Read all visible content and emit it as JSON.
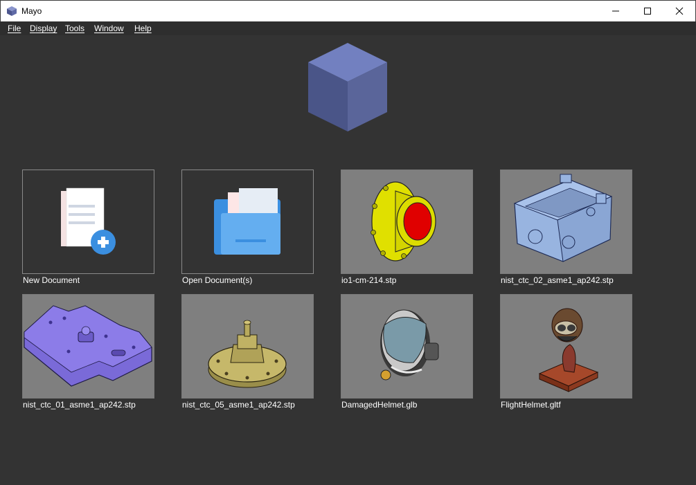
{
  "window": {
    "title": "Mayo",
    "icon": "cube-icon",
    "controls": [
      "minimize-icon",
      "maximize-icon",
      "close-icon"
    ]
  },
  "menu": [
    "File",
    "Display",
    "Tools",
    "Window",
    "Help"
  ],
  "actions": {
    "new_document": "New Document",
    "open_documents": "Open Document(s)"
  },
  "recent_files": [
    "io1-cm-214.stp",
    "nist_ctc_02_asme1_ap242.stp",
    "nist_ctc_01_asme1_ap242.stp",
    "nist_ctc_05_asme1_ap242.stp",
    "DamagedHelmet.glb",
    "FlightHelmet.gltf"
  ],
  "colors": {
    "background": "#333333",
    "thumbnail_bg": "#7f7f7f",
    "logo_cube": "#6b78b3",
    "accent_blue": "#3b8fe0"
  }
}
